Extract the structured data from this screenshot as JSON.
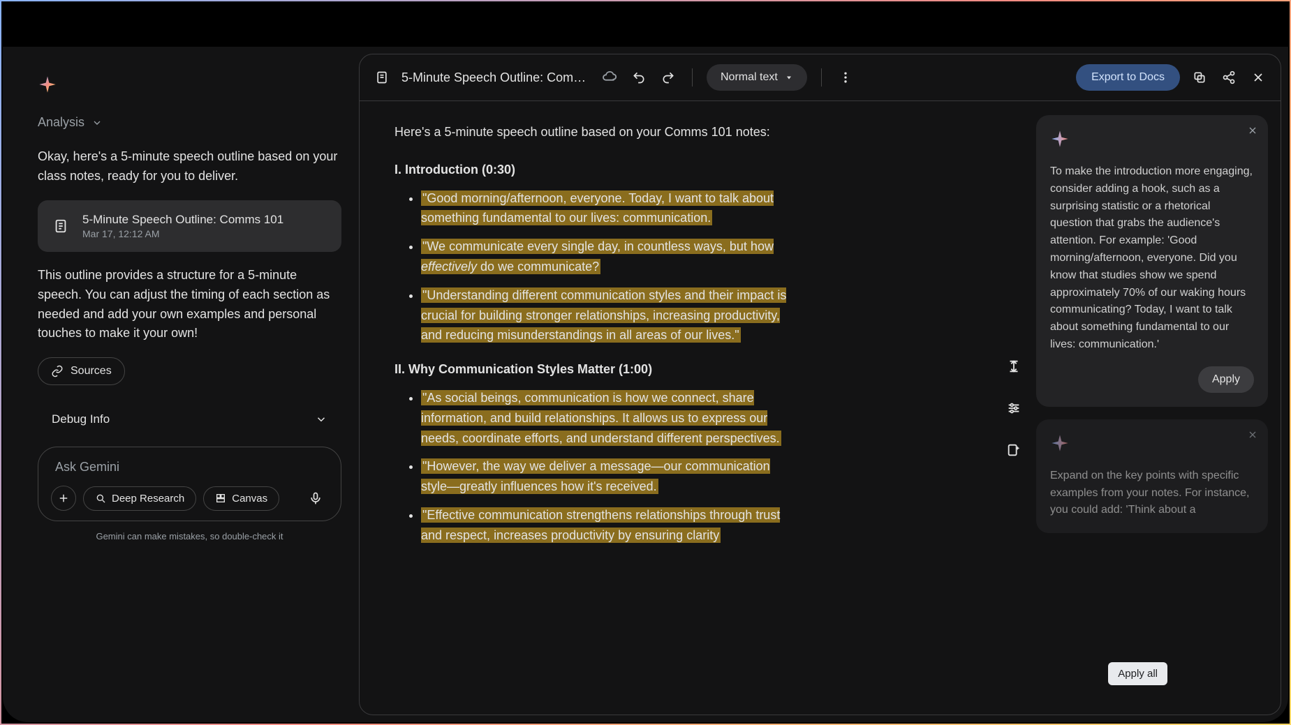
{
  "left": {
    "analysis_label": "Analysis",
    "intro_text": "Okay, here's a 5-minute speech outline based on your class notes, ready for you to deliver.",
    "file": {
      "title": "5-Minute Speech Outline: Comms 101",
      "date": "Mar 17, 12:12 AM"
    },
    "followup_text": "This outline provides a structure for a 5-minute speech.  You can adjust the timing of each section as needed and add your own examples and personal touches to make it your own!",
    "sources_label": "Sources",
    "debug_label": "Debug Info",
    "input_placeholder": "Ask Gemini",
    "chip_deep": "Deep Research",
    "chip_canvas": "Canvas",
    "disclaimer": "Gemini can make mistakes, so double-check it"
  },
  "doc": {
    "title": "5-Minute Speech Outline: Comm…",
    "normal_text_label": "Normal text",
    "export_label": "Export to Docs",
    "intro": "Here's a 5-minute speech outline based on your Comms 101 notes:",
    "h1": "I. Introduction (0:30)",
    "s1_b1": "\"Good morning/afternoon, everyone. Today, I want to talk about something fundamental to our lives: communication.",
    "s1_b2a": "\"We communicate every single day, in countless ways, but how ",
    "s1_b2b": "effectively",
    "s1_b2c": " do we communicate?",
    "s1_b3": "\"Understanding different communication styles and their impact is crucial for building stronger relationships, increasing productivity, and reducing misunderstandings in all areas of our lives.\"",
    "h2": "II. Why Communication Styles Matter (1:00)",
    "s2_b1": "\"As social beings, communication is how we connect, share information, and build relationships. It allows us to express our needs, coordinate efforts, and understand different perspectives.",
    "s2_b2": "\"However, the way we deliver a message—our communication style—greatly influences how it's received.",
    "s2_b3": "\"Effective communication strengthens relationships through trust and respect, increases productivity by ensuring clarity"
  },
  "sugg": {
    "card1": "To make the introduction more engaging, consider adding a hook, such as a surprising statistic or a rhetorical question that grabs the audience's attention. For example: 'Good morning/afternoon, everyone. Did you know that studies show we spend approximately 70% of our waking hours communicating? Today, I want to talk about something fundamental to our lives: communication.'",
    "apply_label": "Apply",
    "card2": "Expand on the key points with specific examples from your notes. For instance, you could add: 'Think about a",
    "apply_all": "Apply all"
  }
}
